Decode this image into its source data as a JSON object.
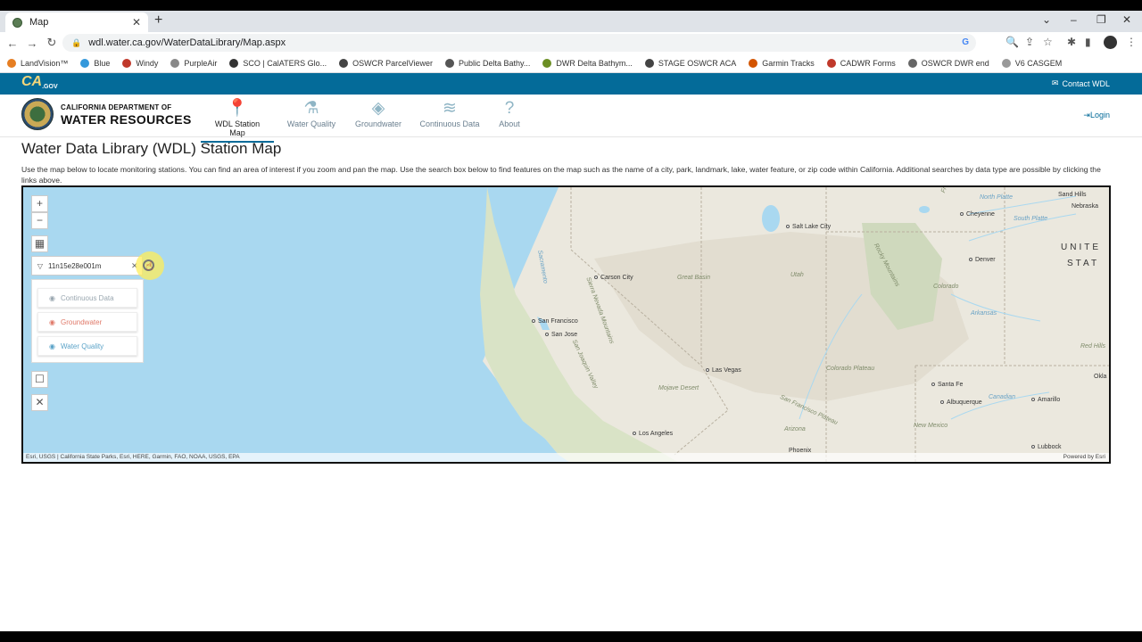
{
  "browser": {
    "tab_title": "Map",
    "url": "wdl.water.ca.gov/WaterDataLibrary/Map.aspx",
    "bookmarks": [
      "LandVision™",
      "Blue",
      "Windy",
      "PurpleAir",
      "SCO | CalATERS Glo...",
      "OSWCR ParcelViewer",
      "Public Delta Bathy...",
      "DWR Delta Bathym...",
      "STAGE OSWCR ACA",
      "Garmin Tracks",
      "CADWR Forms",
      "OSWCR DWR end",
      "V6 CASGEM"
    ]
  },
  "cagov": {
    "logo": "CA",
    "logo_sub": ".GOV",
    "contact": "Contact WDL"
  },
  "header": {
    "dept_line1": "CALIFORNIA DEPARTMENT OF",
    "dept_line2": "WATER RESOURCES",
    "nav": [
      "WDL Station Map",
      "Water Quality",
      "Groundwater",
      "Continuous Data",
      "About"
    ],
    "login": "Login"
  },
  "page": {
    "title": "Water Data Library (WDL) Station Map",
    "intro": "Use the map below to locate monitoring stations. You can find an area of interest if you zoom and pan the map. Use the search box below to find features on the map such as the name of a city, park, landmark, lake, water feature, or zip code within California. Additional searches by data type are possible by clicking the links above."
  },
  "map": {
    "search_value": "11n15e28e001m",
    "layers": [
      "Continuous Data",
      "Groundwater",
      "Water Quality"
    ],
    "layer_colors": [
      "#9aa7b0",
      "#e07a6a",
      "#5ba3c8"
    ],
    "attribution": "Esri, USGS | California State Parks, Esri, HERE, Garmin, FAO, NOAA, USGS, EPA",
    "powered_by": "Powered by Esri",
    "cities": [
      "Salt Lake City",
      "Cheyenne",
      "Denver",
      "Carson City",
      "San Francisco",
      "San Jose",
      "Las Vegas",
      "Santa Fe",
      "Albuquerque",
      "Amarillo",
      "Los Angeles",
      "Phoenix",
      "Lubbock"
    ],
    "terrain_labels": [
      "Great Basin",
      "Utah",
      "Colorado",
      "Rocky Mountains",
      "Front Range",
      "Colorado Plateau",
      "New Mexico",
      "Arizona",
      "Mojave Desert",
      "Sierra Nevada Mountains",
      "San Joaquin Valley",
      "Sacramento",
      "Nebraska",
      "Sand Hills",
      "Red Hills",
      "Okla",
      "North Platte",
      "South Platte",
      "Arkansas",
      "Canadian",
      "San Francisco Plateau"
    ],
    "country_label_1": "UNITE",
    "country_label_2": "STAT"
  }
}
